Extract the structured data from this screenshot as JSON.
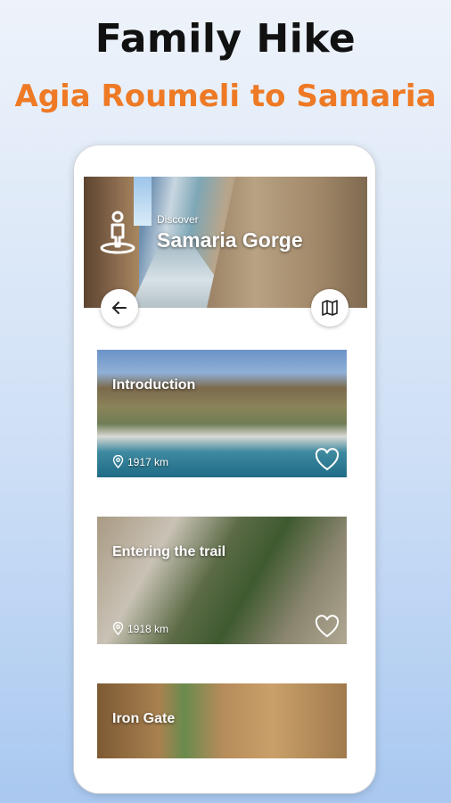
{
  "header": {
    "title": "Family Hike",
    "subtitle": "Agia Roumeli to Samaria"
  },
  "hero": {
    "kicker": "Discover",
    "title": "Samaria Gorge"
  },
  "icons": {
    "hero": "hiker-location-icon",
    "back": "arrow-left-icon",
    "map": "map-icon",
    "pin": "location-pin-icon",
    "favorite": "heart-outline-icon"
  },
  "cards": [
    {
      "title": "Introduction",
      "distance": "1917 km"
    },
    {
      "title": "Entering the trail",
      "distance": "1918 km"
    },
    {
      "title": "Iron Gate"
    }
  ],
  "colors": {
    "subtitle": "#ee7a25",
    "title": "#111111"
  }
}
